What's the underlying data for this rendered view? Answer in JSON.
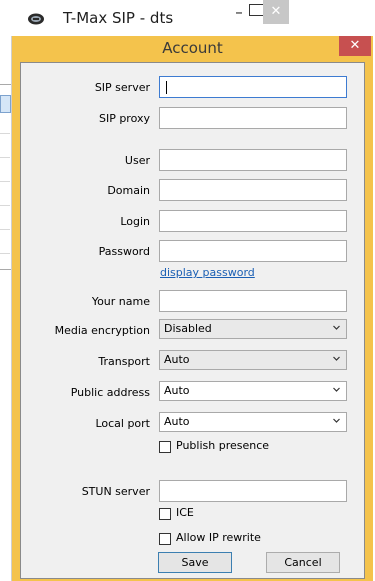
{
  "main_window": {
    "title": "T-Max SIP - dts",
    "controls": {
      "minimize": "–",
      "close": "✕"
    }
  },
  "dialog": {
    "title": "Account",
    "close": "✕",
    "labels": {
      "sip_server": "SIP server",
      "sip_proxy": "SIP proxy",
      "user": "User",
      "domain": "Domain",
      "login": "Login",
      "password": "Password",
      "display_password": "display password",
      "your_name": "Your name",
      "media_encryption": "Media encryption",
      "transport": "Transport",
      "public_address": "Public address",
      "local_port": "Local port",
      "publish_presence": "Publish presence",
      "stun_server": "STUN server",
      "ice": "ICE",
      "allow_ip_rewrite": "Allow IP rewrite"
    },
    "values": {
      "sip_server": "",
      "sip_proxy": "",
      "user": "",
      "domain": "",
      "login": "",
      "password": "",
      "your_name": "",
      "media_encryption": "Disabled",
      "transport": "Auto",
      "public_address": "Auto",
      "local_port": "Auto",
      "stun_server": ""
    },
    "checkboxes": {
      "publish_presence": false,
      "ice": false,
      "allow_ip_rewrite": false
    },
    "buttons": {
      "save": "Save",
      "cancel": "Cancel"
    }
  },
  "colors": {
    "dialog_frame": "#f4c34c",
    "dialog_close": "#c75050",
    "link": "#1a5fb4"
  }
}
